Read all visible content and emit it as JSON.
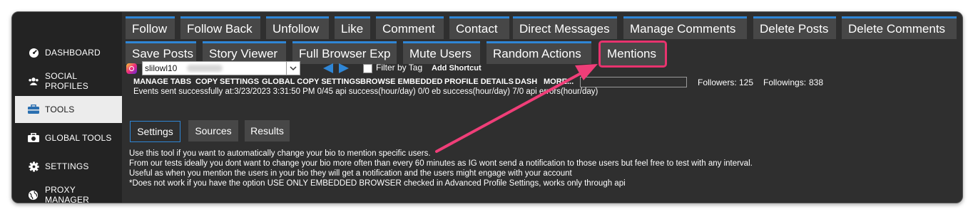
{
  "sidebar": {
    "items": [
      {
        "label": "DASHBOARD",
        "icon": "dashboard-icon"
      },
      {
        "label": "SOCIAL PROFILES",
        "icon": "users-icon"
      },
      {
        "label": "TOOLS",
        "icon": "toolbox-icon",
        "active": true
      },
      {
        "label": "GLOBAL TOOLS",
        "icon": "global-tools-icon"
      },
      {
        "label": "SETTINGS",
        "icon": "gear-icon"
      },
      {
        "label": "PROXY MANAGER",
        "icon": "globe-icon"
      }
    ]
  },
  "tool_tabs": {
    "row1": [
      "Follow",
      "Follow Back",
      "Unfollow",
      "Like",
      "Comment",
      "Contact",
      "Direct Messages",
      "Manage Comments",
      "Delete Posts",
      "Delete Comments"
    ],
    "row2": [
      "Save Posts",
      "Story Viewer",
      "Full Browser Exp",
      "Mute Users",
      "Random Actions",
      "Mentions"
    ],
    "highlighted": "Mentions",
    "accent": "#2f86d6",
    "highlight_color": "#e8336e"
  },
  "profile": {
    "username": "slilowl10"
  },
  "controls": {
    "filter_by_tag": "Filter by Tag",
    "add_shortcut": "Add Shortcut"
  },
  "toolbar": {
    "manage_tabs": "MANAGE TABS",
    "copy_settings": "COPY SETTINGS",
    "global_copy_settings": "GLOBAL COPY SETTINGS",
    "browse_embedded": "BROWSE EMBEDDED",
    "profile_details": "PROFILE DETAILS",
    "dash": "DASH",
    "more": "MORE..."
  },
  "stats": {
    "followers_label": "Followers:",
    "followers_value": "125",
    "followings_label": "Followings:",
    "followings_value": "838"
  },
  "status_line": "Events sent successfully at:3/23/2023 3:31:50 PM 0/45 api success(hour/day) 0/0 eb success(hour/day) 7/0 api errors(hour/day)",
  "sub_tabs": [
    "Settings",
    "Sources",
    "Results"
  ],
  "description": [
    "Use this tool if you want to automatically change your bio to mention specific users.",
    "From our tests ideally you dont want to change your bio more often than every 60 minutes as IG wont send a notification to those users but feel free to test with any interval.",
    "Useful as when you mention the users in your bio they will get a notification and the users might engage with your account",
    "*Does not work if you have the option USE ONLY EMBEDDED BROWSER checked in Advanced Profile Settings, works only through api"
  ]
}
